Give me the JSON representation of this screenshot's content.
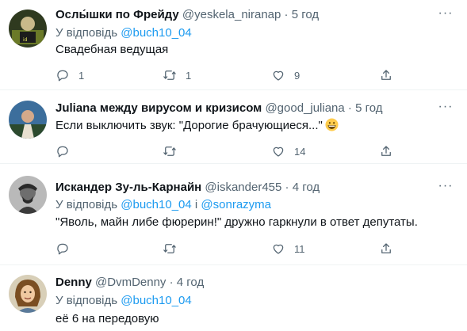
{
  "tweets": [
    {
      "name": "Ослы́шки по Фрейду",
      "handle": "@yeskela_niranap",
      "sep": "·",
      "time": "5 год",
      "reply_prefix": "У відповідь",
      "reply_to": "@buch10_04",
      "text": "Свадебная ведущая",
      "replies": "1",
      "retweets": "1",
      "likes": "9",
      "more": "···"
    },
    {
      "name": "Juliana между вирусом и кризисом",
      "handle": "@good_juliana",
      "sep": "·",
      "time": "5 год",
      "text": "Если выключить звук: \"Дорогие брачующиеся...\"",
      "emoji": "grinning-face-icon",
      "replies": "",
      "retweets": "",
      "likes": "14",
      "more": "···"
    },
    {
      "name": "Искандер Зу-ль-Карнайн",
      "handle": "@iskander455",
      "sep": "·",
      "time": "4 год",
      "reply_prefix": "У відповідь",
      "reply_to": "@buch10_04",
      "reply_join": "і",
      "reply_to2": "@sonrazyma",
      "text": "\"Яволь, майн либе фюрерин!\" дружно гаркнули в ответ депутаты.",
      "replies": "",
      "retweets": "",
      "likes": "11",
      "more": "···"
    },
    {
      "name": "Denny",
      "handle": "@DvmDenny",
      "sep": "·",
      "time": "4 год",
      "reply_prefix": "У відповідь",
      "reply_to": "@buch10_04",
      "text": "её 6 на передовую"
    }
  ],
  "colors": {
    "text": "#0f1419",
    "secondary": "#536471",
    "link": "#1d9bf0",
    "divider": "#eff3f4"
  }
}
